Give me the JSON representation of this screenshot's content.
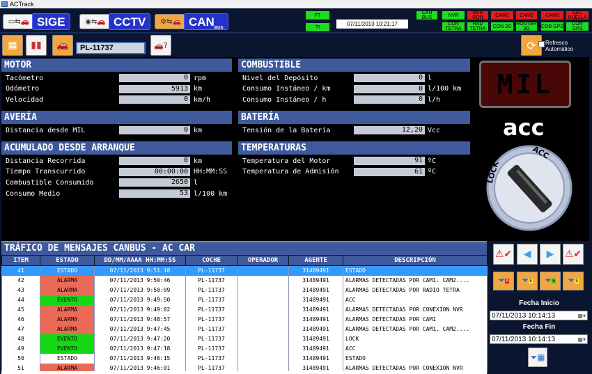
{
  "window": {
    "title": "ACTrack"
  },
  "modules": [
    {
      "label": "SIGE",
      "icon": "car-computer-icon"
    },
    {
      "label": "CCTV",
      "icon": "camera-car-icon"
    },
    {
      "label": "CAN",
      "sub": "BUS",
      "icon": "can-bus-icon"
    }
  ],
  "status": {
    "ft": "FT",
    "ti": "TI",
    "datetime": "07/11/2013 10:21:17",
    "top": [
      {
        "label": "CAN BUS",
        "color": "#1fdc1f"
      },
      {
        "label": "NVR",
        "color": "#1fdc1f"
      },
      {
        "label": "NVR RON",
        "color": "#e11c1c"
      },
      {
        "label": "CAM1",
        "color": "#e11c1c"
      },
      {
        "label": "CAM2",
        "color": "#e11c1c"
      },
      {
        "label": "CAM3",
        "color": "#e11c1c"
      },
      {
        "label": "LEC HUELLA",
        "color": "#e11c1c"
      }
    ],
    "bottom": [
      {
        "label": "CON TETRA",
        "color": "#1fdc1f"
      },
      {
        "label": "RAD TETRA",
        "color": "#1fdc1f"
      },
      {
        "label": "CON 3G",
        "color": "#1fdc1f"
      },
      {
        "label": "ROUTER 3G",
        "color": "#1fdc1f"
      },
      {
        "label": "COB GPS",
        "color": "#1fdc1f"
      },
      {
        "label": "CON GPS",
        "color": "#1fdc1f"
      }
    ]
  },
  "toolbar": {
    "plate": "PL-11737",
    "refresh_label_1": "Refresco",
    "refresh_label_2": "Automático"
  },
  "motor": {
    "title": "MOTOR",
    "rows": [
      {
        "label": "Tacómetro",
        "value": "0",
        "unit": "rpm"
      },
      {
        "label": "Odómetro",
        "value": "5913",
        "unit": "km"
      },
      {
        "label": "Velocidad",
        "value": "0",
        "unit": "km/h"
      }
    ]
  },
  "combustible": {
    "title": "COMBUSTIBLE",
    "rows": [
      {
        "label": "Nivel del Depósito",
        "value": "0",
        "unit": "l"
      },
      {
        "label": "Consumo Instáneo / km",
        "value": "0",
        "unit": "l/100 km"
      },
      {
        "label": "Consumo Instáneo / h",
        "value": "0",
        "unit": "l/h"
      }
    ]
  },
  "averia": {
    "title": "AVERÍA",
    "rows": [
      {
        "label": "Distancia desde MIL",
        "value": "0",
        "unit": "km"
      }
    ]
  },
  "bateria": {
    "title": "BATERÍA",
    "rows": [
      {
        "label": "Tensión de la Batería",
        "value": "12,20",
        "unit": "Vcc"
      }
    ]
  },
  "acumulado": {
    "title": "ACUMULADO DESDE ARRANQUE",
    "rows": [
      {
        "label": "Distancia Recorrida",
        "value": "0",
        "unit": "km"
      },
      {
        "label": "Tiempo Transcurrido",
        "value": "00:00:00",
        "unit": "HH:MM:SS"
      },
      {
        "label": "Combustible Consumido",
        "value": "2650",
        "unit": "l"
      },
      {
        "label": "Consumo Medio",
        "value": "53",
        "unit": "l/100 km"
      }
    ]
  },
  "temperaturas": {
    "title": "TEMPERATURAS",
    "rows": [
      {
        "label": "Temperatura del Motor",
        "value": "91",
        "unit": "ºC"
      },
      {
        "label": "Temperatura de Admisión",
        "value": "61",
        "unit": "ºC"
      }
    ]
  },
  "indicators": {
    "mil": "MIL",
    "acc": "acc",
    "key_lock": "LOCK",
    "key_acc": "ACC"
  },
  "traffic": {
    "title": "TRÁFICO DE MENSAJES CANBUS - AC CAR",
    "columns": [
      "ITEM",
      "ESTADO",
      "DD/MM/AAAA HH:MM:SS",
      "COCHE",
      "OPERADOR",
      "AGENTE",
      "DESCRIPCIÓN"
    ],
    "rows": [
      {
        "item": "41",
        "estado": "ESTADO",
        "fecha": "07/11/2013 9:51:18",
        "coche": "PL-11737",
        "operador": "",
        "agente": "31489491",
        "desc": "ESTADO"
      },
      {
        "item": "42",
        "estado": "ALARMA",
        "fecha": "07/11/2013 9:50:46",
        "coche": "PL-11737",
        "operador": "",
        "agente": "31489491",
        "desc": "ALARMAS DETECTADAS POR CAM1. CAM2...."
      },
      {
        "item": "43",
        "estado": "ALARMA",
        "fecha": "07/11/2013 9:50:09",
        "coche": "PL-11737",
        "operador": "",
        "agente": "31489491",
        "desc": "ALARMAS DETECTADAS POR RADIO TETRA"
      },
      {
        "item": "44",
        "estado": "EVENTO",
        "fecha": "07/11/2013 9:49:50",
        "coche": "PL-11737",
        "operador": "",
        "agente": "31489491",
        "desc": "ACC"
      },
      {
        "item": "45",
        "estado": "ALARMA",
        "fecha": "07/11/2013 9:49:02",
        "coche": "PL-11737",
        "operador": "",
        "agente": "31489491",
        "desc": "ALARMAS DETECTADAS POR CONEXION NVR"
      },
      {
        "item": "46",
        "estado": "ALARMA",
        "fecha": "07/11/2013 9:48:57",
        "coche": "PL-11737",
        "operador": "",
        "agente": "31489491",
        "desc": "ALARMAS DETECTADAS POR CAM1"
      },
      {
        "item": "47",
        "estado": "ALARMA",
        "fecha": "07/11/2013 9:47:45",
        "coche": "PL-11737",
        "operador": "",
        "agente": "31489491",
        "desc": "ALARMAS DETECTADAS POR CAM1. CAM2...."
      },
      {
        "item": "48",
        "estado": "EVENTO",
        "fecha": "07/11/2013 9:47:20",
        "coche": "PL-11737",
        "operador": "",
        "agente": "31489491",
        "desc": "LOCK"
      },
      {
        "item": "49",
        "estado": "EVENTO",
        "fecha": "07/11/2013 9:47:18",
        "coche": "PL-11737",
        "operador": "",
        "agente": "31489491",
        "desc": "ACC"
      },
      {
        "item": "50",
        "estado": "ESTADO",
        "fecha": "07/11/2013 9:46:15",
        "coche": "PL-11737",
        "operador": "",
        "agente": "31489491",
        "desc": "ESTADO"
      },
      {
        "item": "51",
        "estado": "ALARMA",
        "fecha": "07/11/2013 9:46:01",
        "coche": "PL-11737",
        "operador": "",
        "agente": "31489491",
        "desc": "ALARMAS DETECTADAS POR CONEXION NVR"
      }
    ]
  },
  "filters": {
    "fecha_inicio_label": "Fecha Inicio",
    "fecha_inicio": "07/11/2013 10:14:13",
    "fecha_fin_label": "Fecha Fin",
    "fecha_fin": "07/11/2013 10:14:13",
    "filter_letters": [
      "A",
      "E",
      "S"
    ]
  },
  "colors": {
    "alarma": "#e86a57",
    "evento": "#15d815",
    "section_header": "#3f5a9c",
    "selected": "#3399ff"
  }
}
